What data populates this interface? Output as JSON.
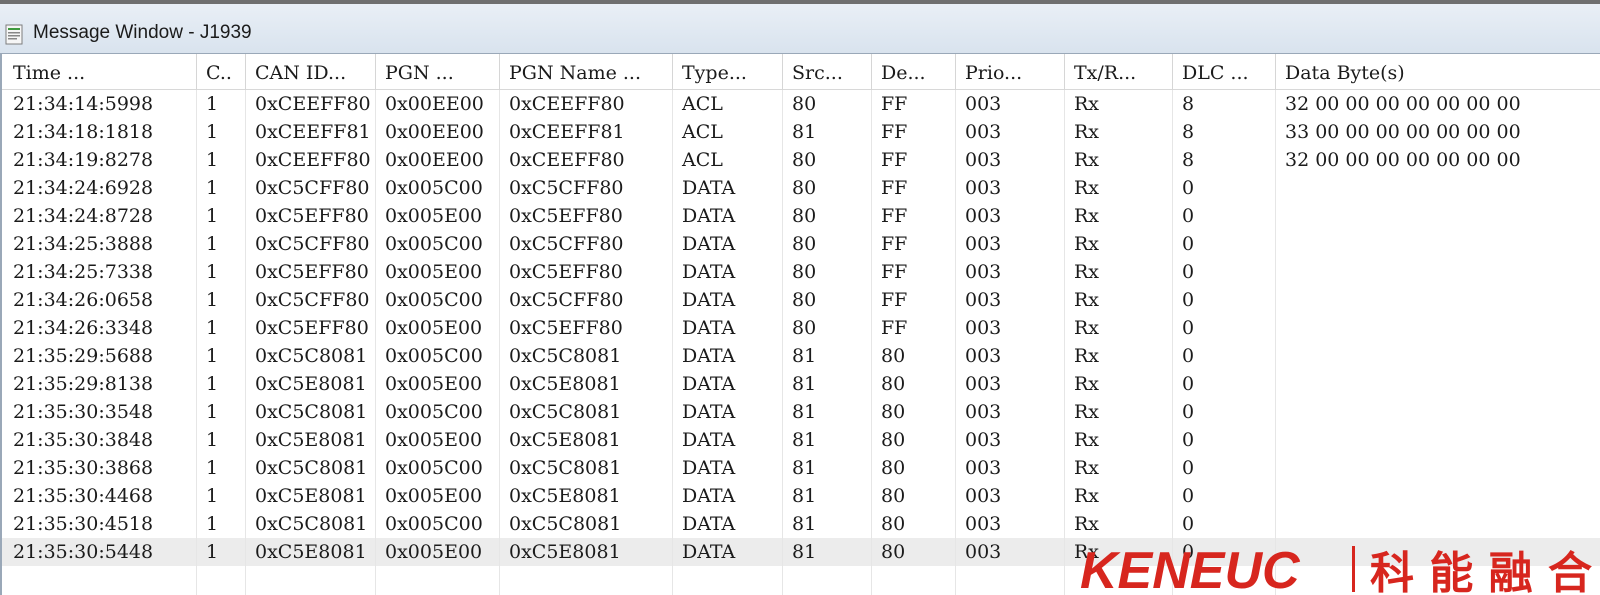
{
  "window": {
    "title": "Message Window - J1939",
    "icon": "message-window-icon"
  },
  "table": {
    "columns": [
      "Time      ...",
      "C..",
      "CAN ID...",
      "PGN    ...",
      "PGN Name  ...",
      "Type...",
      "Src...",
      "De...",
      "Prio...",
      "Tx/R...",
      "DLC  ...",
      "Data Byte(s)"
    ],
    "rows": [
      [
        "21:34:14:5998",
        "1",
        "0xCEEFF80",
        "0x00EE00",
        "0xCEEFF80",
        "ACL",
        "80",
        "FF",
        "003",
        "Rx",
        "8",
        "32 00 00 00 00 00 00 00"
      ],
      [
        "21:34:18:1818",
        "1",
        "0xCEEFF81",
        "0x00EE00",
        "0xCEEFF81",
        "ACL",
        "81",
        "FF",
        "003",
        "Rx",
        "8",
        "33 00 00 00 00 00 00 00"
      ],
      [
        "21:34:19:8278",
        "1",
        "0xCEEFF80",
        "0x00EE00",
        "0xCEEFF80",
        "ACL",
        "80",
        "FF",
        "003",
        "Rx",
        "8",
        "32 00 00 00 00 00 00 00"
      ],
      [
        "21:34:24:6928",
        "1",
        "0xC5CFF80",
        "0x005C00",
        "0xC5CFF80",
        "DATA",
        "80",
        "FF",
        "003",
        "Rx",
        "0",
        ""
      ],
      [
        "21:34:24:8728",
        "1",
        "0xC5EFF80",
        "0x005E00",
        "0xC5EFF80",
        "DATA",
        "80",
        "FF",
        "003",
        "Rx",
        "0",
        ""
      ],
      [
        "21:34:25:3888",
        "1",
        "0xC5CFF80",
        "0x005C00",
        "0xC5CFF80",
        "DATA",
        "80",
        "FF",
        "003",
        "Rx",
        "0",
        ""
      ],
      [
        "21:34:25:7338",
        "1",
        "0xC5EFF80",
        "0x005E00",
        "0xC5EFF80",
        "DATA",
        "80",
        "FF",
        "003",
        "Rx",
        "0",
        ""
      ],
      [
        "21:34:26:0658",
        "1",
        "0xC5CFF80",
        "0x005C00",
        "0xC5CFF80",
        "DATA",
        "80",
        "FF",
        "003",
        "Rx",
        "0",
        ""
      ],
      [
        "21:34:26:3348",
        "1",
        "0xC5EFF80",
        "0x005E00",
        "0xC5EFF80",
        "DATA",
        "80",
        "FF",
        "003",
        "Rx",
        "0",
        ""
      ],
      [
        "21:35:29:5688",
        "1",
        "0xC5C8081",
        "0x005C00",
        "0xC5C8081",
        "DATA",
        "81",
        "80",
        "003",
        "Rx",
        "0",
        ""
      ],
      [
        "21:35:29:8138",
        "1",
        "0xC5E8081",
        "0x005E00",
        "0xC5E8081",
        "DATA",
        "81",
        "80",
        "003",
        "Rx",
        "0",
        ""
      ],
      [
        "21:35:30:3548",
        "1",
        "0xC5C8081",
        "0x005C00",
        "0xC5C8081",
        "DATA",
        "81",
        "80",
        "003",
        "Rx",
        "0",
        ""
      ],
      [
        "21:35:30:3848",
        "1",
        "0xC5E8081",
        "0x005E00",
        "0xC5E8081",
        "DATA",
        "81",
        "80",
        "003",
        "Rx",
        "0",
        ""
      ],
      [
        "21:35:30:3868",
        "1",
        "0xC5C8081",
        "0x005C00",
        "0xC5C8081",
        "DATA",
        "81",
        "80",
        "003",
        "Rx",
        "0",
        ""
      ],
      [
        "21:35:30:4468",
        "1",
        "0xC5E8081",
        "0x005E00",
        "0xC5E8081",
        "DATA",
        "81",
        "80",
        "003",
        "Rx",
        "0",
        ""
      ],
      [
        "21:35:30:4518",
        "1",
        "0xC5C8081",
        "0x005C00",
        "0xC5C8081",
        "DATA",
        "81",
        "80",
        "003",
        "Rx",
        "0",
        ""
      ],
      [
        "21:35:30:5448",
        "1",
        "0xC5E8081",
        "0x005E00",
        "0xC5E8081",
        "DATA",
        "81",
        "80",
        "003",
        "Rx",
        "0",
        ""
      ]
    ],
    "selected_row": 16,
    "colors": {
      "selected_row_bg": "#ececec",
      "grid_line": "#e6e6e6",
      "titlebar": "#dde6f0"
    }
  },
  "watermark": {
    "latin": "KENEUC",
    "cjk": "科能融合",
    "color": "#d7261e"
  }
}
